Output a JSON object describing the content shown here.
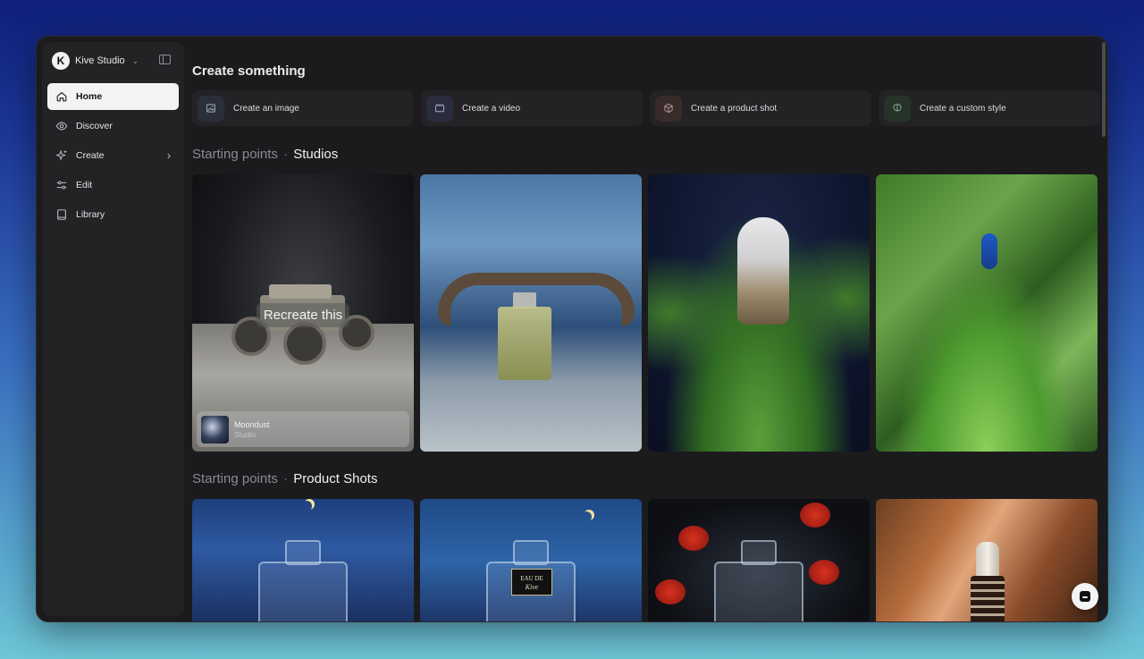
{
  "brand": {
    "name": "Kive Studio",
    "logo_letter": "K"
  },
  "sidebar": {
    "items": [
      {
        "label": "Home",
        "icon": "home-icon",
        "active": true
      },
      {
        "label": "Discover",
        "icon": "eye-icon"
      },
      {
        "label": "Create",
        "icon": "sparkle-icon",
        "has_submenu": true
      },
      {
        "label": "Edit",
        "icon": "sliders-icon"
      },
      {
        "label": "Library",
        "icon": "book-icon"
      }
    ]
  },
  "main": {
    "heading": "Create something",
    "create_actions": [
      {
        "label": "Create an image",
        "icon": "image-icon",
        "icon_bg": "#2a2f3a"
      },
      {
        "label": "Create a video",
        "icon": "video-icon",
        "icon_bg": "#2a2d3e"
      },
      {
        "label": "Create a product shot",
        "icon": "box-icon",
        "icon_bg": "#3a2b2b"
      },
      {
        "label": "Create a custom style",
        "icon": "brain-icon",
        "icon_bg": "#263329"
      }
    ],
    "studios_section": {
      "prefix": "Starting points",
      "separator": "·",
      "title": "Studios",
      "hover_label": "Recreate this",
      "studio_chip": {
        "name": "Moondust",
        "type": "Studio"
      }
    },
    "products_section": {
      "prefix": "Starting points",
      "separator": "·",
      "title": "Product Shots",
      "label_text_line1": "EAU DE",
      "label_text_line2": "Kive"
    }
  },
  "colors": {
    "window_bg": "#1b1b1d",
    "sidebar_bg": "#232326",
    "active_nav_bg": "#f3f3f4",
    "card_bg": "#232326"
  }
}
